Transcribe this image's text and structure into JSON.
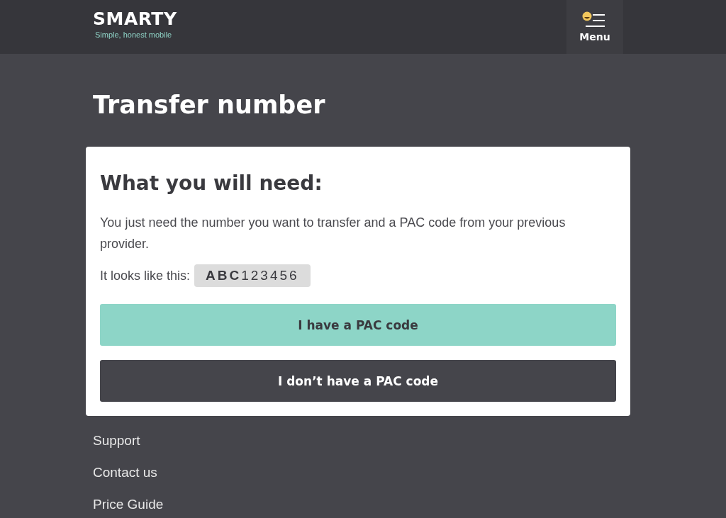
{
  "header": {
    "logo": "SMARTY",
    "tagline": "Simple, honest mobile",
    "menu_label": "Menu"
  },
  "page_title": "Transfer number",
  "card": {
    "heading": "What you will need:",
    "intro": "You just need the number you want to transfer and a PAC code from your previous provider.",
    "example_label": "It looks like this:",
    "example_code": "**ABC**123456",
    "buttons": [
      {
        "label": "I have a PAC code",
        "kind": "primary"
      },
      {
        "label": "I don’t have a PAC code",
        "kind": "secondary"
      }
    ]
  },
  "footer_links": [
    "Support",
    "Contact us",
    "Price Guide"
  ]
}
